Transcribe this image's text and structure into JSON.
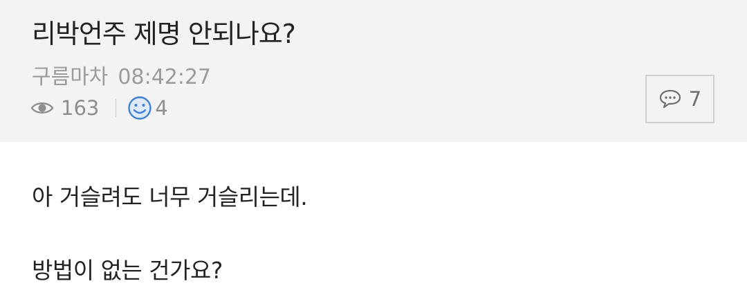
{
  "post": {
    "title": "리박언주 제명 안되나요?",
    "author": "구름마차",
    "time": "08:42:27",
    "views": "163",
    "likes": "4",
    "comments": "7"
  },
  "content": {
    "paragraphs": [
      "아 거슬려도 너무 거슬리는데.",
      "방법이 없는 건가요?"
    ]
  },
  "icons": {
    "views": "eye-icon",
    "likes": "smiley-icon",
    "comments": "speech-bubble-icon"
  },
  "colors": {
    "header_bg": "#f3f3f3",
    "smiley_blue": "#3d7fd6"
  }
}
